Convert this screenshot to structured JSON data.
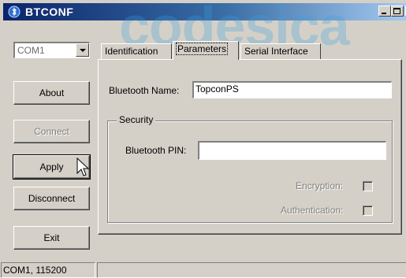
{
  "window": {
    "title": "BTCONF",
    "watermark_text": "codesica",
    "accent": "#0a246a"
  },
  "sidebar": {
    "port_select": {
      "value": "COM1"
    },
    "buttons": {
      "about": "About",
      "connect": "Connect",
      "apply": "Apply",
      "disconnect": "Disconnect",
      "exit": "Exit"
    }
  },
  "tabs": [
    {
      "label": "Identification",
      "active": false
    },
    {
      "label": "Parameters",
      "active": true
    },
    {
      "label": "Serial Interface",
      "active": false
    }
  ],
  "parameters": {
    "bluetooth_name_label": "Bluetooth Name:",
    "bluetooth_name_value": "TopconPS",
    "security_group_label": "Security",
    "bluetooth_pin_label": "Bluetooth PIN:",
    "bluetooth_pin_value": "",
    "encryption_label": "Encryption:",
    "encryption_checked": false,
    "authentication_label": "Authentication:",
    "authentication_checked": false
  },
  "statusbar": {
    "port_info": "COM1, 115200",
    "message": ""
  }
}
